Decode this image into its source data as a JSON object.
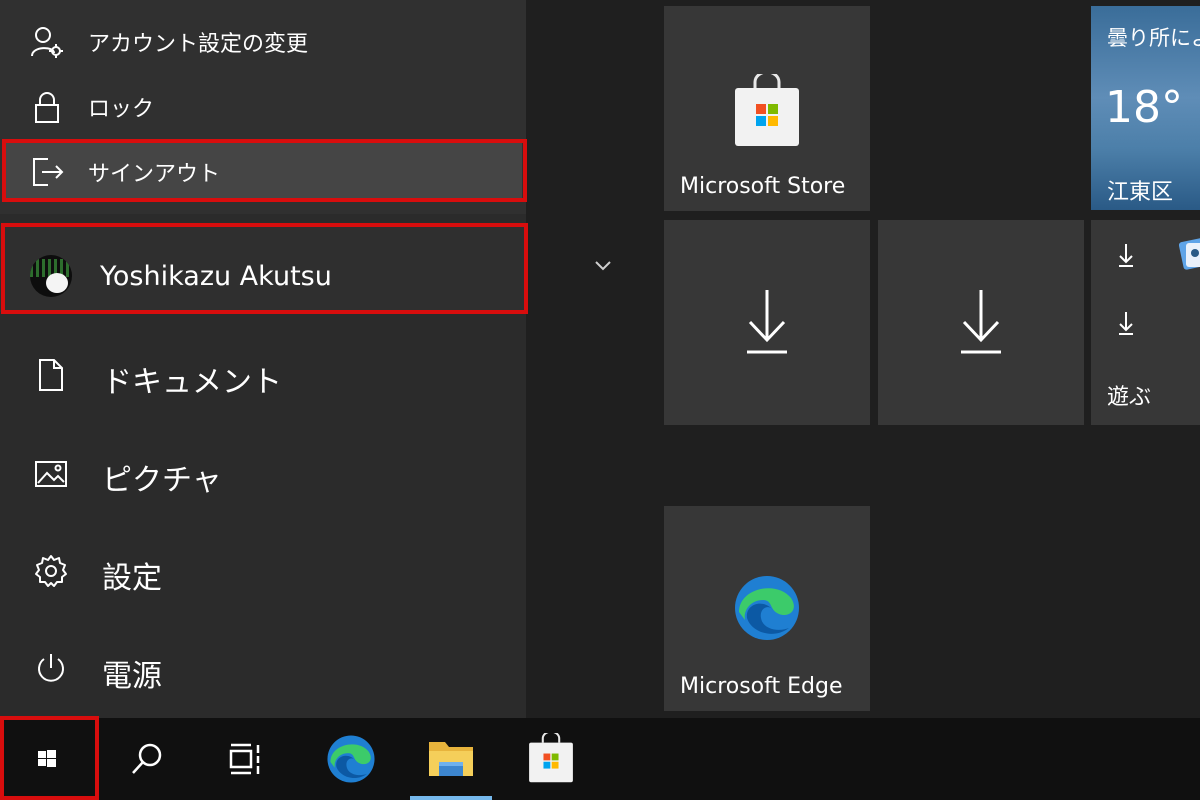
{
  "account_menu": {
    "items": [
      {
        "label": "アカウント設定の変更",
        "icon": "user-settings-icon"
      },
      {
        "label": "ロック",
        "icon": "lock-icon"
      },
      {
        "label": "サインアウト",
        "icon": "sign-out-icon"
      }
    ]
  },
  "user": {
    "name": "Yoshikazu Akutsu",
    "avatar": "avatar-icon"
  },
  "nav": [
    {
      "label": "ドキュメント",
      "icon": "document-icon"
    },
    {
      "label": "ピクチャ",
      "icon": "pictures-icon"
    },
    {
      "label": "設定",
      "icon": "gear-icon"
    },
    {
      "label": "電源",
      "icon": "power-icon"
    }
  ],
  "tiles": {
    "store": {
      "label": "Microsoft Store",
      "icon": "store-bag-icon"
    },
    "weather": {
      "condition": "曇り所によ",
      "temp": "18°",
      "location": "江東区"
    },
    "play": {
      "label": "遊ぶ"
    },
    "edge": {
      "label": "Microsoft Edge",
      "icon": "edge-icon"
    }
  },
  "taskbar": {
    "items": [
      "start-button",
      "search-icon",
      "task-view-icon",
      "edge-icon",
      "file-explorer-icon",
      "store-icon"
    ]
  },
  "colors": {
    "highlight": "#d80d0d",
    "accent": "#76b9ed",
    "tile": "#373737",
    "panel": "#2b2b2b"
  }
}
